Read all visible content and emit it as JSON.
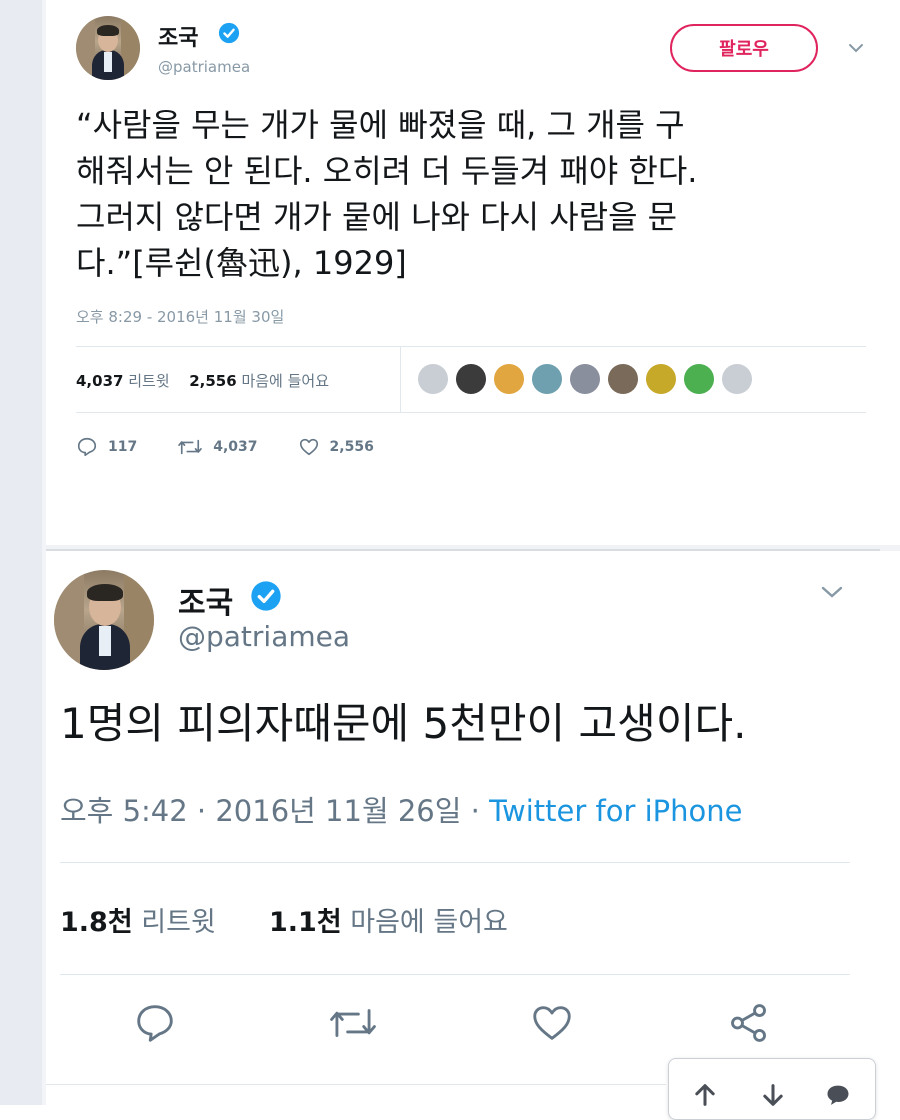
{
  "tweet1": {
    "name": "조국",
    "handle": "@patriamea",
    "follow_label": "팔로우",
    "text_lines": [
      "“사람을 무는 개가 물에 빠졌을 때, 그 개를 구",
      "해줘서는 안 된다. 오히려 더 두들겨 패야 한다.",
      "그러지 않다면 개가 뭍에 나와 다시 사람을 문",
      "다.”[루쉰(魯迅), 1929]"
    ],
    "timestamp": "오후 8:29 - 2016년 11월 30일",
    "retweets_count": "4,037",
    "retweets_label": "리트윗",
    "likes_count": "2,556",
    "likes_label": "마음에 들어요",
    "actions": {
      "reply_count": "117",
      "retweet_count": "4,037",
      "like_count": "2,556"
    },
    "liker_colors": [
      "#c9ced4",
      "#3b3b3b",
      "#e2a640",
      "#6fa0b0",
      "#8a8f9e",
      "#7a6a5a",
      "#c7a92a",
      "#4caf50",
      "#c9ced4"
    ]
  },
  "tweet2": {
    "name": "조국",
    "handle": "@patriamea",
    "text": "1명의 피의자때문에 5천만이 고생이다.",
    "time": "오후 5:42",
    "date": "2016년 11월 26일",
    "source": "Twitter for iPhone",
    "retweets_count": "1.8천",
    "retweets_label": "리트윗",
    "likes_count": "1.1천",
    "likes_label": "마음에 들어요"
  },
  "colors": {
    "accent": "#1da1f2",
    "follow": "#e0245e",
    "muted": "#657786"
  }
}
